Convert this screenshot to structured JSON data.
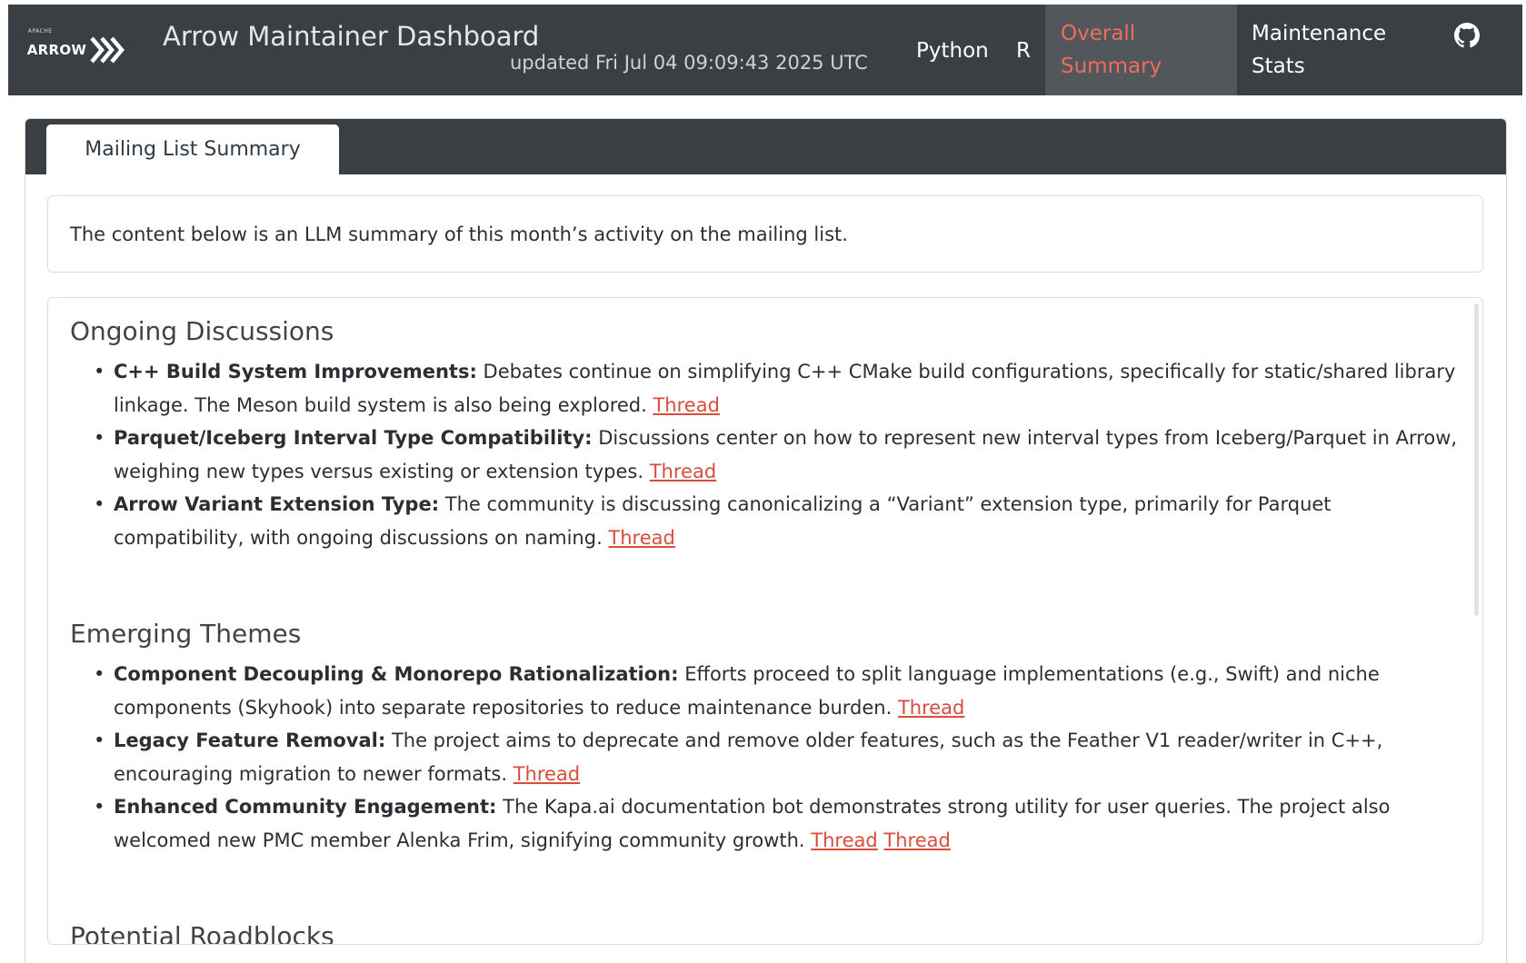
{
  "navbar": {
    "brand_small": "APACHE",
    "brand_word": "ARROW",
    "title": "Arrow Maintainer Dashboard",
    "updated": "updated Fri Jul 04 09:09:43 2025 UTC",
    "items": [
      {
        "label": "Python"
      },
      {
        "label": "R"
      },
      {
        "label": "Overall Summary",
        "active": true
      },
      {
        "label": "Maintenance Stats"
      }
    ],
    "github_icon": "github-icon"
  },
  "card": {
    "tab_label": "Mailing List Summary",
    "note": "The content below is an LLM summary of this month’s activity on the mailing list.",
    "sections": [
      {
        "heading": "Ongoing Discussions",
        "items": [
          {
            "title": "C++ Build System Improvements:",
            "text": " Debates continue on simplifying C++ CMake build configurations, specifically for static/shared library linkage. The Meson build system is also being explored. ",
            "links": [
              "Thread"
            ]
          },
          {
            "title": "Parquet/Iceberg Interval Type Compatibility:",
            "text": " Discussions center on how to represent new interval types from Iceberg/Parquet in Arrow, weighing new types versus existing or extension types. ",
            "links": [
              "Thread"
            ]
          },
          {
            "title": "Arrow Variant Extension Type:",
            "text": " The community is discussing canonicalizing a “Variant” extension type, primarily for Parquet compatibility, with ongoing discussions on naming. ",
            "links": [
              "Thread"
            ]
          }
        ]
      },
      {
        "heading": "Emerging Themes",
        "items": [
          {
            "title": "Component Decoupling & Monorepo Rationalization:",
            "text": " Efforts proceed to split language implementations (e.g., Swift) and niche components (Skyhook) into separate repositories to reduce maintenance burden. ",
            "links": [
              "Thread"
            ]
          },
          {
            "title": "Legacy Feature Removal:",
            "text": " The project aims to deprecate and remove older features, such as the Feather V1 reader/writer in C++, encouraging migration to newer formats. ",
            "links": [
              "Thread"
            ]
          },
          {
            "title": "Enhanced Community Engagement:",
            "text": " The Kapa.ai documentation bot demonstrates strong utility for user queries. The project also welcomed new PMC member Alenka Frim, signifying community growth. ",
            "links": [
              "Thread",
              "Thread"
            ]
          }
        ]
      },
      {
        "heading": "Potential Roadblocks",
        "items": []
      }
    ]
  },
  "colors": {
    "navbar_bg": "#3a3f44",
    "active_nav_bg": "#52575c",
    "accent": "#ee6e5c",
    "link": "#d94d3c"
  }
}
